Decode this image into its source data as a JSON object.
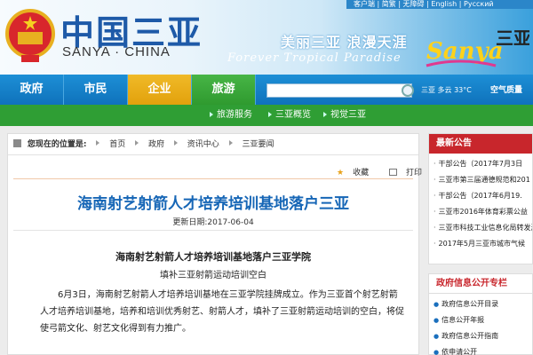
{
  "header": {
    "top_links": "客户端 | 简繁 | 无障碍 | English | Русский",
    "logo_cn": "中国三亚",
    "logo_en": "SANYA · CHINA",
    "slogan_cn": "美丽三亚  浪漫天涯",
    "slogan_en": "Forever Tropical Paradise",
    "brand_text": "Sanya",
    "brand_cn": "三亚"
  },
  "nav": {
    "items": [
      "政府",
      "市民",
      "企业",
      "旅游"
    ],
    "search_placeholder": "",
    "weather": "三亚  多云  33°C",
    "aqi": "空气质量"
  },
  "subnav": {
    "items": [
      "旅游服务",
      "三亚概览",
      "视觉三亚"
    ]
  },
  "breadcrumb": {
    "label": "您现在的位置是:",
    "items": [
      "首页",
      "政府",
      "资讯中心",
      "三亚要闻"
    ]
  },
  "article": {
    "favorite": "收藏",
    "print": "打印",
    "title": "海南射艺射箭人才培养培训基地落户三亚",
    "date": "更新日期:2017-06-04",
    "subtitle": "海南射艺射箭人才培养培训基地落户三亚学院",
    "subtitle2": "填补三亚射箭运动培训空白",
    "body": "6月3日，海南射艺射箭人才培养培训基地在三亚学院挂牌成立。作为三亚首个射艺射箭人才培养培训基地，培养和培训优秀射艺、射箭人才，填补了三亚射箭运动培训的空白，将促使弓箭文化、射艺文化得到有力推广。"
  },
  "side": {
    "news_title": "最新公告",
    "news": [
      "干部公告（2017年7月3日",
      "三亚市第三届通德规范和201",
      "干部公告（2017年6月19.",
      "三亚市2016年体育彩票公益",
      "三亚市科技工业信息化局转发海",
      "2017年5月三亚市城市气候"
    ],
    "gov_title": "政府信息公开专栏",
    "gov": [
      "政府信息公开目录",
      "信息公开年报",
      "政府信息公开指南",
      "依申请公开"
    ]
  }
}
